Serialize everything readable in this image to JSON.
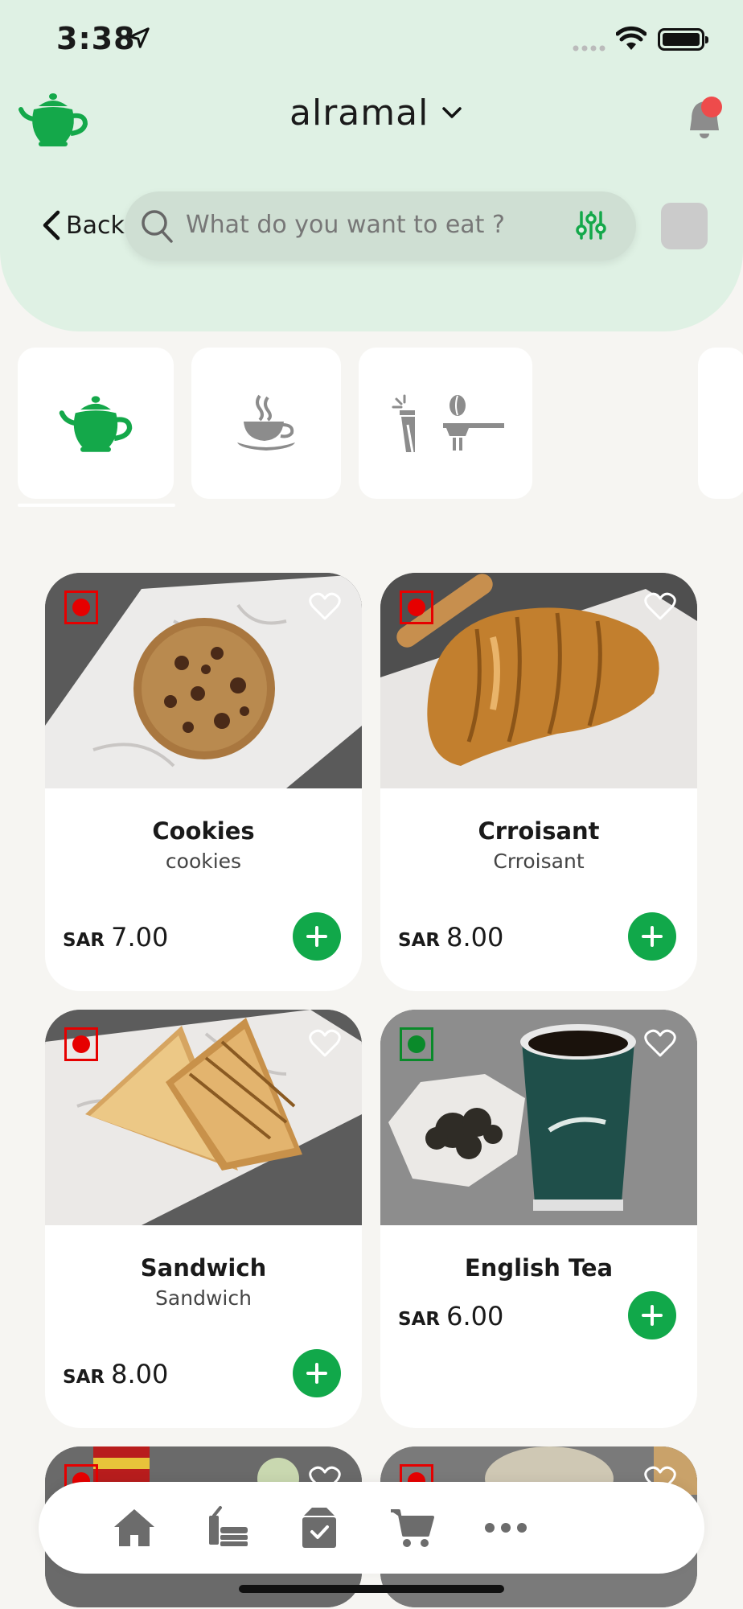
{
  "status_bar": {
    "time": "3:38"
  },
  "header": {
    "location": "alramal",
    "back_label": "Back",
    "search_placeholder": "What do you want to eat ?"
  },
  "categories": [
    {
      "icon": "teapot-icon",
      "selected": true
    },
    {
      "icon": "coffee-cup-icon",
      "selected": false
    },
    {
      "icon": "cold-drink-icon",
      "selected": false
    },
    {
      "icon": "espresso-machine-icon",
      "selected": false
    }
  ],
  "products": [
    {
      "name": "Cookies",
      "subtitle": "cookies",
      "currency": "SAR",
      "price": "7.00",
      "indicator": "red"
    },
    {
      "name": "Crroisant",
      "subtitle": "Crroisant",
      "currency": "SAR",
      "price": "8.00",
      "indicator": "red"
    },
    {
      "name": "Sandwich",
      "subtitle": "Sandwich",
      "currency": "SAR",
      "price": "8.00",
      "indicator": "red"
    },
    {
      "name": "English Tea",
      "subtitle": "",
      "currency": "SAR",
      "price": "6.00",
      "indicator": "green"
    }
  ],
  "bottom_nav": [
    "home-icon",
    "menu-icon",
    "orders-icon",
    "cart-icon",
    "more-icon"
  ],
  "colors": {
    "brand_green": "#11a84a",
    "header_bg": "#dff1e4",
    "indicator_red": "#e60000",
    "indicator_green": "#0a8a2a"
  }
}
